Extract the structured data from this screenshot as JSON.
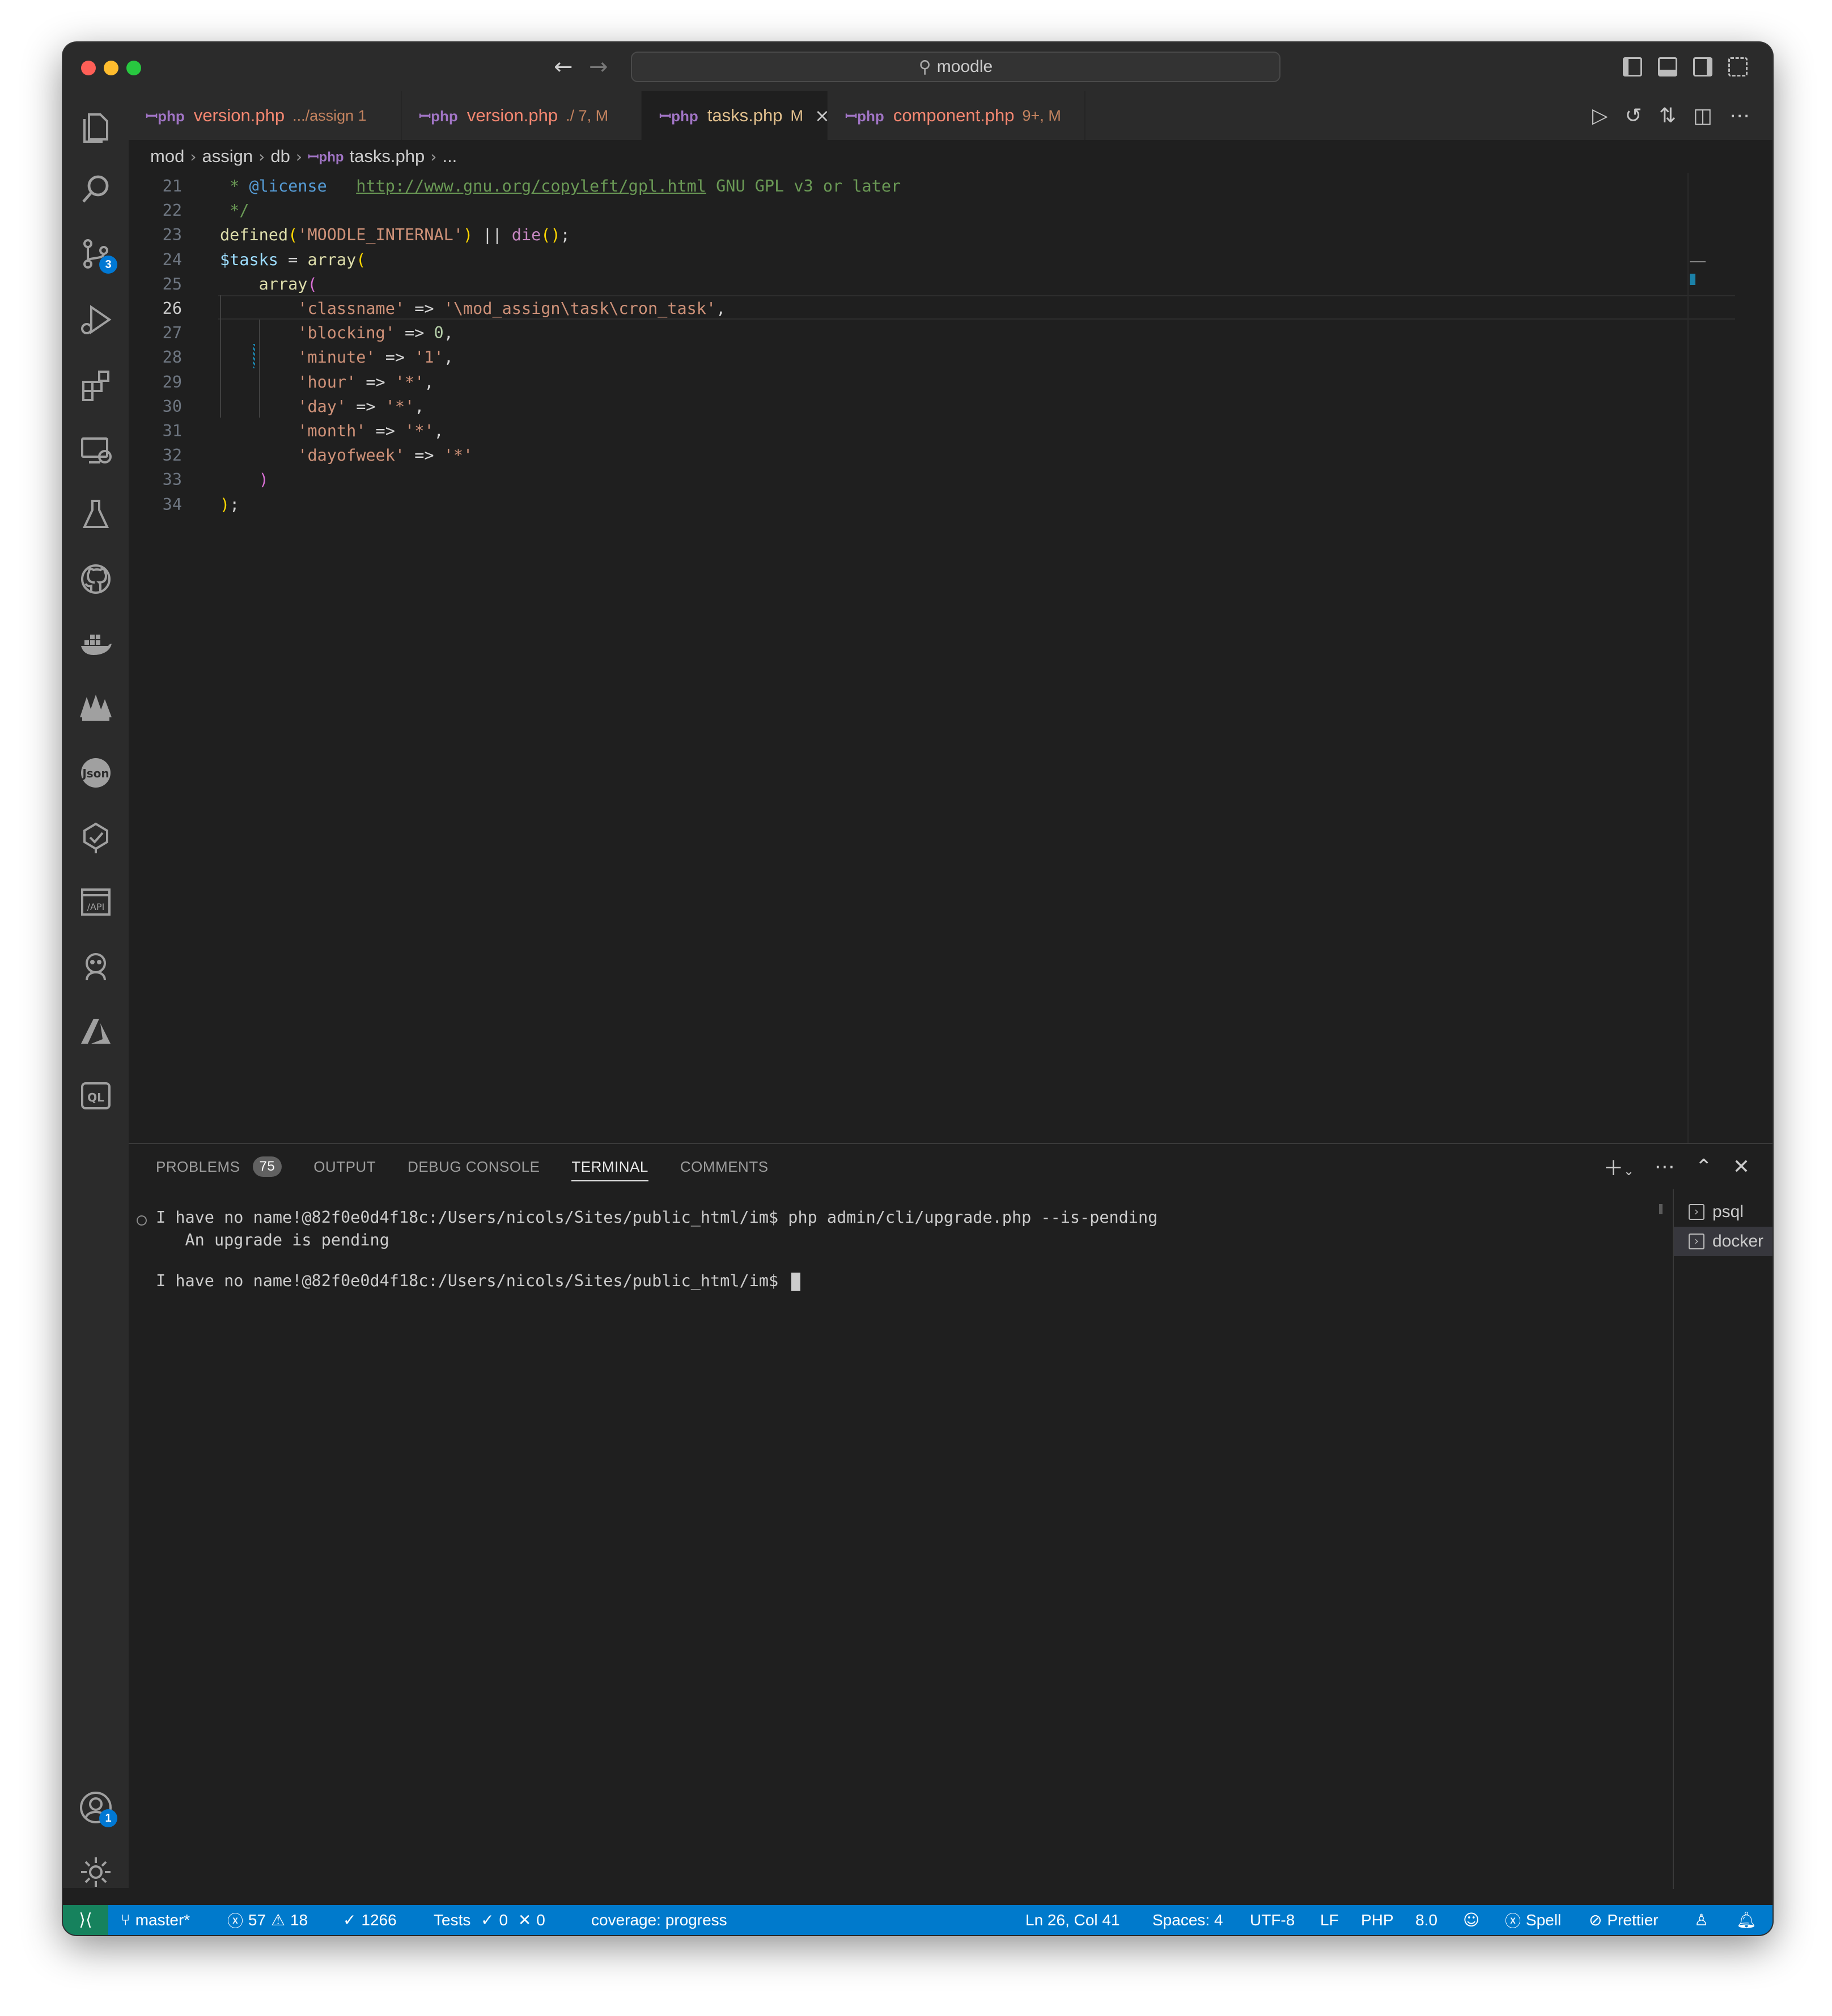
{
  "window": {
    "search_text": "moodle"
  },
  "activity_bar": {
    "source_control_badge": "3",
    "accounts_badge": "1"
  },
  "tabs": [
    {
      "name": "version.php",
      "desc": ".../assign 1"
    },
    {
      "name": "version.php",
      "desc": "./ 7, M"
    },
    {
      "name": "tasks.php",
      "desc": "M",
      "close": "×"
    },
    {
      "name": "component.php",
      "desc": "9+, M"
    }
  ],
  "breadcrumb": [
    "mod",
    "assign",
    "db",
    "tasks.php",
    "..."
  ],
  "code": {
    "lines": [
      {
        "n": "21",
        "seg": [
          [
            "c-com",
            " * "
          ],
          [
            "c-tag",
            "@license"
          ],
          [
            "c-com",
            "   "
          ],
          [
            "c-link",
            "http://www.gnu.org/copyleft/gpl.html"
          ],
          [
            "c-com",
            " GNU GPL v3 or later"
          ]
        ]
      },
      {
        "n": "22",
        "seg": [
          [
            "c-com",
            " */"
          ]
        ]
      },
      {
        "n": "23",
        "seg": [
          [
            "c-fn",
            "defined"
          ],
          [
            "c-p1",
            "("
          ],
          [
            "c-str",
            "'MOODLE_INTERNAL'"
          ],
          [
            "c-p1",
            ")"
          ],
          [
            "c-op",
            " || "
          ],
          [
            "c-kw",
            "die"
          ],
          [
            "c-p1",
            "()"
          ],
          [
            "c-op",
            ";"
          ]
        ]
      },
      {
        "n": "24",
        "seg": [
          [
            "c-var",
            "$tasks"
          ],
          [
            "c-op",
            " = "
          ],
          [
            "c-fn",
            "array"
          ],
          [
            "c-p1",
            "("
          ]
        ]
      },
      {
        "n": "25",
        "seg": [
          [
            "c-op",
            "    "
          ],
          [
            "c-fn",
            "array"
          ],
          [
            "c-p2",
            "("
          ]
        ]
      },
      {
        "n": "26",
        "seg": [
          [
            "c-op",
            "        "
          ],
          [
            "c-str",
            "'classname'"
          ],
          [
            "c-op",
            " => "
          ],
          [
            "c-str",
            "'\\mod_assign\\task\\cron_task'"
          ],
          [
            "c-op",
            ","
          ]
        ]
      },
      {
        "n": "27",
        "seg": [
          [
            "c-op",
            "        "
          ],
          [
            "c-str",
            "'blocking'"
          ],
          [
            "c-op",
            " => "
          ],
          [
            "c-num",
            "0"
          ],
          [
            "c-op",
            ","
          ]
        ]
      },
      {
        "n": "28",
        "seg": [
          [
            "c-op",
            "        "
          ],
          [
            "c-str",
            "'minute'"
          ],
          [
            "c-op",
            " => "
          ],
          [
            "c-str",
            "'1'"
          ],
          [
            "c-op",
            ","
          ]
        ]
      },
      {
        "n": "29",
        "seg": [
          [
            "c-op",
            "        "
          ],
          [
            "c-str",
            "'hour'"
          ],
          [
            "c-op",
            " => "
          ],
          [
            "c-str",
            "'*'"
          ],
          [
            "c-op",
            ","
          ]
        ]
      },
      {
        "n": "30",
        "seg": [
          [
            "c-op",
            "        "
          ],
          [
            "c-str",
            "'day'"
          ],
          [
            "c-op",
            " => "
          ],
          [
            "c-str",
            "'*'"
          ],
          [
            "c-op",
            ","
          ]
        ]
      },
      {
        "n": "31",
        "seg": [
          [
            "c-op",
            "        "
          ],
          [
            "c-str",
            "'month'"
          ],
          [
            "c-op",
            " => "
          ],
          [
            "c-str",
            "'*'"
          ],
          [
            "c-op",
            ","
          ]
        ]
      },
      {
        "n": "32",
        "seg": [
          [
            "c-op",
            "        "
          ],
          [
            "c-str",
            "'dayofweek'"
          ],
          [
            "c-op",
            " => "
          ],
          [
            "c-str",
            "'*'"
          ]
        ]
      },
      {
        "n": "33",
        "seg": [
          [
            "c-op",
            "    "
          ],
          [
            "c-p2",
            ")"
          ]
        ]
      },
      {
        "n": "34",
        "seg": [
          [
            "c-p1",
            ")"
          ],
          [
            "c-op",
            ";"
          ]
        ]
      }
    ]
  },
  "panel": {
    "tabs": [
      "PROBLEMS",
      "OUTPUT",
      "DEBUG CONSOLE",
      "TERMINAL",
      "COMMENTS"
    ],
    "problems_count": "75",
    "terminal": {
      "line1": "I have no name!@82f0e0d4f18c:/Users/nicols/Sites/public_html/im$ php admin/cli/upgrade.php --is-pending",
      "line2": "   An upgrade is pending",
      "line3": "I have no name!@82f0e0d4f18c:/Users/nicols/Sites/public_html/im$ "
    },
    "terminals": [
      "psql",
      "docker"
    ]
  },
  "status": {
    "branch": "master*",
    "errors": "57",
    "warnings": "18",
    "checks": "1266",
    "tests_label": "Tests",
    "tests_pass": "0",
    "tests_fail": "0",
    "coverage": "coverage: progress",
    "position": "Ln 26, Col 41",
    "spaces": "Spaces: 4",
    "encoding": "UTF-8",
    "eol": "LF",
    "language": "PHP",
    "version": "8.0",
    "spell": "Spell",
    "prettier": "Prettier"
  },
  "colors": {
    "status_bar": "#007acc",
    "remote": "#16825d",
    "badge": "#0078d4"
  }
}
